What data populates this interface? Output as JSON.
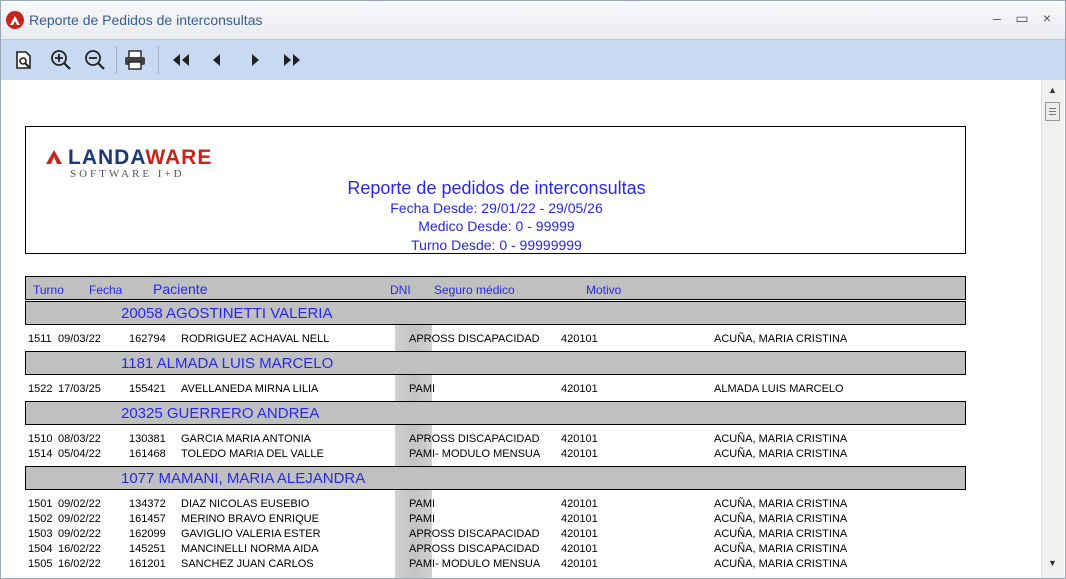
{
  "window": {
    "title": "Reporte de Pedidos de interconsultas",
    "minimize": "–",
    "maximize": "▭",
    "close": "×"
  },
  "toolbar": {
    "preview_icon": "page-preview-icon",
    "zoom_in_icon": "zoom-in-icon",
    "zoom_out_icon": "zoom-out-icon",
    "print_icon": "printer-icon",
    "first_icon": "first-page-icon",
    "prev_icon": "previous-page-icon",
    "next_icon": "next-page-icon",
    "last_icon": "last-page-icon"
  },
  "report": {
    "logo": {
      "name_a": "LANDA",
      "name_b": "WARE",
      "tagline": "SOFTWARE I+D"
    },
    "title": "Reporte de pedidos de interconsultas",
    "line1": "Fecha Desde: 29/01/22 - 29/05/26",
    "line2": "Medico Desde: 0 - 99999",
    "line3": "Turno Desde: 0 - 99999999",
    "columns": {
      "turno": "Turno",
      "fecha": "Fecha",
      "paciente": "Paciente",
      "dni": "DNI",
      "seguro": "Seguro médico",
      "motivo": "Motivo"
    },
    "groups": [
      {
        "label": "20058 AGOSTINETTI VALERIA",
        "rows": [
          {
            "turno": "1511",
            "fecha": "09/03/22",
            "hc": "162794",
            "paciente": "RODRIGUEZ ACHAVAL NELL",
            "seguro": "APROSS DISCAPACIDAD",
            "motivo": "420101",
            "medico": "ACUÑA, MARIA CRISTINA"
          }
        ]
      },
      {
        "label": "1181 ALMADA LUIS MARCELO",
        "rows": [
          {
            "turno": "1522",
            "fecha": "17/03/25",
            "hc": "155421",
            "paciente": "AVELLANEDA MIRNA LILIA",
            "seguro": "PAMI",
            "motivo": "420101",
            "medico": "ALMADA LUIS MARCELO"
          }
        ]
      },
      {
        "label": "20325 GUERRERO ANDREA",
        "rows": [
          {
            "turno": "1510",
            "fecha": "08/03/22",
            "hc": "130381",
            "paciente": "GARCIA MARIA ANTONIA",
            "seguro": "APROSS DISCAPACIDAD",
            "motivo": "420101",
            "medico": "ACUÑA, MARIA CRISTINA"
          },
          {
            "turno": "1514",
            "fecha": "05/04/22",
            "hc": "161468",
            "paciente": "TOLEDO MARIA DEL VALLE",
            "seguro": "PAMI- MODULO MENSUA",
            "motivo": "420101",
            "medico": "ACUÑA, MARIA CRISTINA"
          }
        ]
      },
      {
        "label": "1077 MAMANI, MARIA ALEJANDRA",
        "rows": [
          {
            "turno": "1501",
            "fecha": "09/02/22",
            "hc": "134372",
            "paciente": "DIAZ NICOLAS EUSEBIO",
            "seguro": "PAMI",
            "motivo": "420101",
            "medico": "ACUÑA, MARIA CRISTINA"
          },
          {
            "turno": "1502",
            "fecha": "09/02/22",
            "hc": "161457",
            "paciente": "MERINO BRAVO ENRIQUE",
            "seguro": "PAMI",
            "motivo": "420101",
            "medico": "ACUÑA, MARIA CRISTINA"
          },
          {
            "turno": "1503",
            "fecha": "09/02/22",
            "hc": "162099",
            "paciente": "GAVIGLIO VALERIA ESTER",
            "seguro": "APROSS DISCAPACIDAD",
            "motivo": "420101",
            "medico": "ACUÑA, MARIA CRISTINA"
          },
          {
            "turno": "1504",
            "fecha": "16/02/22",
            "hc": "145251",
            "paciente": "MANCINELLI NORMA AIDA",
            "seguro": "APROSS DISCAPACIDAD",
            "motivo": "420101",
            "medico": "ACUÑA, MARIA CRISTINA"
          },
          {
            "turno": "1505",
            "fecha": "16/02/22",
            "hc": "161201",
            "paciente": "SANCHEZ JUAN CARLOS",
            "seguro": "PAMI- MODULO MENSUA",
            "motivo": "420101",
            "medico": "ACUÑA, MARIA CRISTINA"
          }
        ]
      }
    ]
  },
  "colors": {
    "report_blue": "#2828ee",
    "toolbar_bg": "#c8daf2",
    "group_bg": "#c0c0c0",
    "brand_red": "#c8231c",
    "brand_navy": "#1a3a78"
  }
}
